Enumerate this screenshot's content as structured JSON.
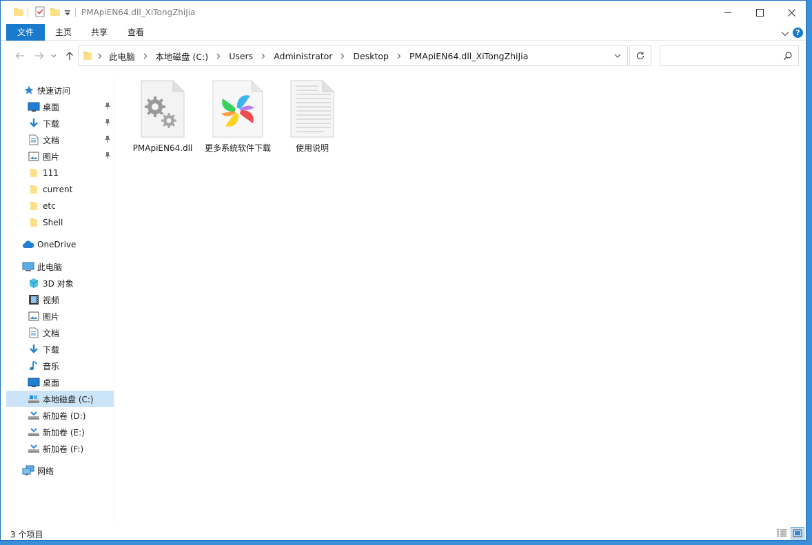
{
  "window": {
    "title": "PMApiEN64.dll_XiTongZhiJia"
  },
  "ribbon": {
    "tabs": [
      {
        "label": "文件"
      },
      {
        "label": "主页"
      },
      {
        "label": "共享"
      },
      {
        "label": "查看"
      }
    ],
    "help_label": "?"
  },
  "address": {
    "crumbs": [
      "此电脑",
      "本地磁盘 (C:)",
      "Users",
      "Administrator",
      "Desktop",
      "PMApiEN64.dll_XiTongZhiJia"
    ]
  },
  "search": {
    "value": "",
    "placeholder": ""
  },
  "sidebar": {
    "quick_access": "快速访问",
    "quick_items": [
      {
        "label": "桌面",
        "icon": "desktop-icon",
        "pinned": true
      },
      {
        "label": "下载",
        "icon": "download-icon",
        "pinned": true
      },
      {
        "label": "文档",
        "icon": "document-icon",
        "pinned": true
      },
      {
        "label": "图片",
        "icon": "pictures-icon",
        "pinned": true
      },
      {
        "label": "111",
        "icon": "folder-icon",
        "pinned": false
      },
      {
        "label": "current",
        "icon": "folder-icon",
        "pinned": false
      },
      {
        "label": "etc",
        "icon": "folder-icon",
        "pinned": false
      },
      {
        "label": "Shell",
        "icon": "folder-icon",
        "pinned": false
      }
    ],
    "onedrive": "OneDrive",
    "this_pc": "此电脑",
    "pc_items": [
      {
        "label": "3D 对象",
        "icon": "3d-objects-icon"
      },
      {
        "label": "视频",
        "icon": "video-icon"
      },
      {
        "label": "图片",
        "icon": "pictures-icon"
      },
      {
        "label": "文档",
        "icon": "document-icon"
      },
      {
        "label": "下载",
        "icon": "download-icon"
      },
      {
        "label": "音乐",
        "icon": "music-icon"
      },
      {
        "label": "桌面",
        "icon": "desktop-icon"
      },
      {
        "label": "本地磁盘 (C:)",
        "icon": "drive-icon",
        "selected": true
      },
      {
        "label": "新加卷 (D:)",
        "icon": "drive-icon"
      },
      {
        "label": "新加卷 (E:)",
        "icon": "drive-icon"
      },
      {
        "label": "新加卷 (F:)",
        "icon": "drive-icon"
      }
    ],
    "network": "网络"
  },
  "files": [
    {
      "name": "PMApiEN64.dll",
      "icon": "dll-gear-icon"
    },
    {
      "name": "更多系统软件下载",
      "icon": "pinwheel-icon"
    },
    {
      "name": "使用说明",
      "icon": "text-file-icon"
    }
  ],
  "status": {
    "item_count": "3 个项目"
  },
  "colors": {
    "accent": "#1979ca",
    "selection": "#cce4f7"
  }
}
